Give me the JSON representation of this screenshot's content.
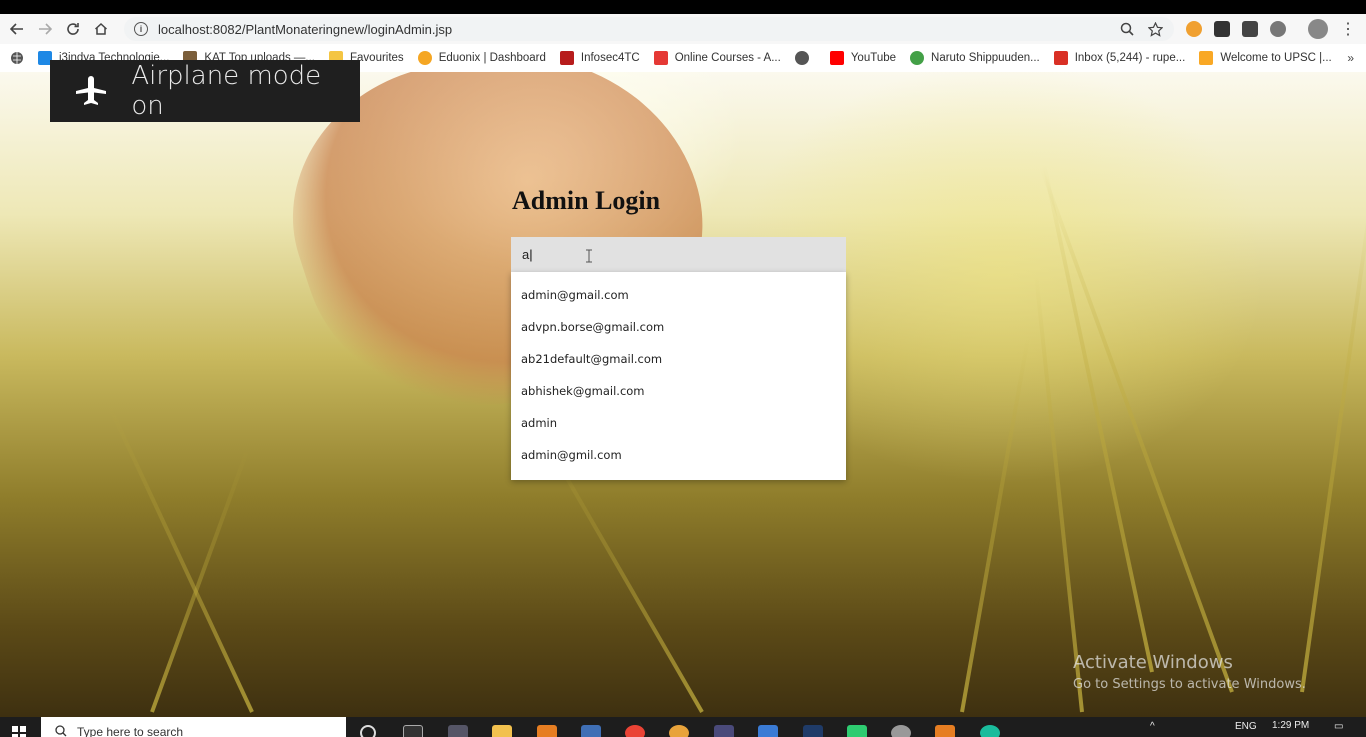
{
  "browser": {
    "url": "localhost:8082/PlantMonateringnew/loginAdmin.jsp"
  },
  "bookmarks": [
    {
      "label": "i3indya Technologie...",
      "icon": "check-square-icon",
      "color": "#1e88e5"
    },
    {
      "label": "KAT Top uploads —...",
      "icon": "torrent-icon",
      "color": "#7b5e3b"
    },
    {
      "label": "Favourites",
      "icon": "folder-icon",
      "color": "#f4c542"
    },
    {
      "label": "Eduonix | Dashboard",
      "icon": "eduonix-icon",
      "color": "#f5a623"
    },
    {
      "label": "Infosec4TC",
      "icon": "shield-icon",
      "color": "#b71c1c"
    },
    {
      "label": "Online Courses - A...",
      "icon": "udemy-icon",
      "color": "#e53935"
    },
    {
      "label": "",
      "icon": "globe-icon",
      "color": "#555555"
    },
    {
      "label": "YouTube",
      "icon": "youtube-icon",
      "color": "#ff0000"
    },
    {
      "label": "Naruto Shippuuden...",
      "icon": "naruto-icon",
      "color": "#43a047"
    },
    {
      "label": "Inbox (5,244) - rupe...",
      "icon": "gmail-icon",
      "color": "#d93025"
    },
    {
      "label": "Welcome to UPSC |...",
      "icon": "upsc-icon",
      "color": "#f9a825"
    }
  ],
  "notification": {
    "text": "Airplane mode on"
  },
  "login": {
    "title": "Admin Login",
    "email_value": "a",
    "suggestions": [
      "admin@gmail.com",
      "advpn.borse@gmail.com",
      "ab21default@gmail.com",
      "abhishek@gmail.com",
      "admin",
      "admin@gmil.com"
    ]
  },
  "watermark": {
    "line1": "Activate Windows",
    "line2": "Go to Settings to activate Windows."
  },
  "taskbar": {
    "search_placeholder": "Type here to search",
    "time": "1:29 PM",
    "language": "ENG"
  }
}
